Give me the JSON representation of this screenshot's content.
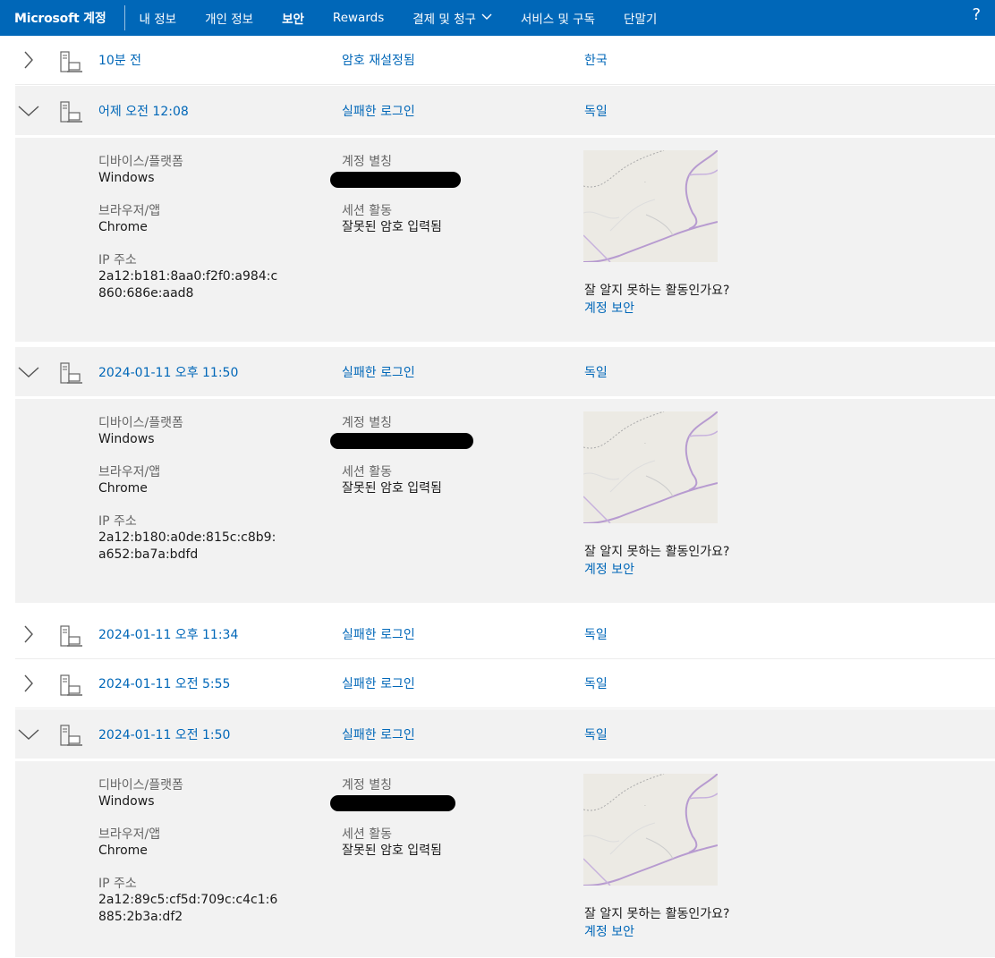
{
  "header": {
    "brand": "Microsoft 계정",
    "nav": [
      {
        "label": "내 정보",
        "active": false
      },
      {
        "label": "개인 정보",
        "active": false
      },
      {
        "label": "보안",
        "active": true
      },
      {
        "label": "Rewards",
        "active": false
      },
      {
        "label": "결제 및 청구",
        "active": false,
        "dropdown": true
      },
      {
        "label": "서비스 및 구독",
        "active": false
      },
      {
        "label": "단말기",
        "active": false
      }
    ],
    "help": "?"
  },
  "labels": {
    "device_platform": "디바이스/플랫폼",
    "browser_app": "브라우저/앱",
    "ip_address": "IP 주소",
    "account_alias": "계정 별칭",
    "session_activity": "세션 활동",
    "unknown_question": "잘 알지 못하는 활동인가요?",
    "secure_account": "계정 보안"
  },
  "events": [
    {
      "time": "10분 전",
      "activity": "암호 재설정됨",
      "location": "한국",
      "expanded": false
    },
    {
      "time": "어제 오전 12:08",
      "activity": "실패한 로그인",
      "location": "독일",
      "expanded": true,
      "device": "Windows",
      "browser": "Chrome",
      "ip_line1": "2a12:b181:8aa0:f2f0:a984:c",
      "ip_line2": "860:686e:aad8",
      "session": "잘못된 암호 입력됨"
    },
    {
      "time": "2024-01-11 오후 11:50",
      "activity": "실패한 로그인",
      "location": "독일",
      "expanded": true,
      "device": "Windows",
      "browser": "Chrome",
      "ip_line1": "2a12:b180:a0de:815c:c8b9:",
      "ip_line2": "a652:ba7a:bdfd",
      "session": "잘못된 암호 입력됨"
    },
    {
      "time": "2024-01-11 오후 11:34",
      "activity": "실패한 로그인",
      "location": "독일",
      "expanded": false
    },
    {
      "time": "2024-01-11 오전 5:55",
      "activity": "실패한 로그인",
      "location": "독일",
      "expanded": false
    },
    {
      "time": "2024-01-11 오전 1:50",
      "activity": "실패한 로그인",
      "location": "독일",
      "expanded": true,
      "device": "Windows",
      "browser": "Chrome",
      "ip_line1": "2a12:89c5:cf5d:709c:c4c1:6",
      "ip_line2": "885:2b3a:df2",
      "session": "잘못된 암호 입력됨"
    }
  ],
  "icons": {
    "collapsed": "chevron-right-icon",
    "expanded": "chevron-down-icon",
    "device": "desktop-device-icon"
  },
  "colors": {
    "brand_blue": "#0067b8",
    "panel_gray": "#f2f2f2"
  }
}
